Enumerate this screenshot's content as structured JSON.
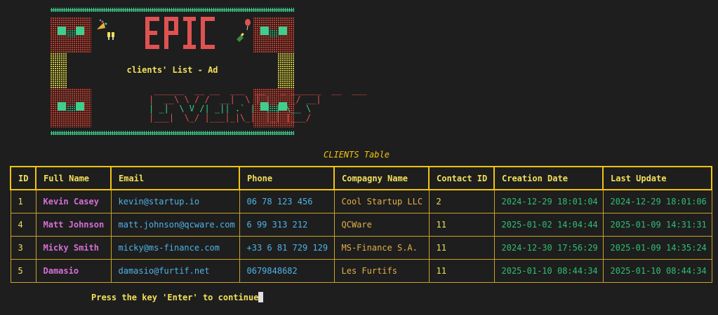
{
  "banner": {
    "title": "EPIC",
    "subtitle": "clients' List - Ad",
    "ascii_line1": " ______  __ __  ___  __   _ ______  __  ___ ",
    "ascii_line2": "|  __\\ \\ / /  __|  \\ | |_   _/ __|",
    "ascii_line3": "| _|  \\ V /| _|| .` |  | | \\__ \\",
    "ascii_line4": "|___|  \\_/ |___|_|\\_|  |_| |___/",
    "colors": {
      "frame_green": "#3ecf8e",
      "frame_red": "#c0392b",
      "frame_yellow": "#c9c13a",
      "title_red": "#e05252"
    },
    "icons": [
      "party-popper-icon",
      "clinking-glasses-icon",
      "balloon-icon",
      "champagne-bottle-icon"
    ]
  },
  "table": {
    "title": "CLIENTS Table",
    "columns": [
      "ID",
      "Full Name",
      "Email",
      "Phone",
      "Compagny Name",
      "Contact ID",
      "Creation Date",
      "Last Update"
    ],
    "rows": [
      [
        "1",
        "Kevin Casey",
        "kevin@startup.io",
        "06 78 123 456",
        "Cool Startup LLC",
        "2",
        "2024-12-29 18:01:04",
        "2024-12-29 18:01:06"
      ],
      [
        "4",
        "Matt Johnson",
        "matt.johnson@qcware.com",
        "6 99 313 212",
        "QCWare",
        "11",
        "2025-01-02 14:04:44",
        "2025-01-09 14:31:31"
      ],
      [
        "3",
        "Micky Smith",
        "micky@ms-finance.com",
        "+33 6 81 729 129",
        "MS-Finance S.A.",
        "11",
        "2024-12-30 17:56:29",
        "2025-01-09 14:35:24"
      ],
      [
        "5",
        "Damasio",
        "damasio@furtif.net",
        "0679848682",
        "Les Furtifs",
        "11",
        "2025-01-10 08:44:34",
        "2025-01-10 08:44:34"
      ]
    ],
    "border_color": "#f1c40f"
  },
  "prompt": {
    "text": "Press the key 'Enter' to continue"
  }
}
